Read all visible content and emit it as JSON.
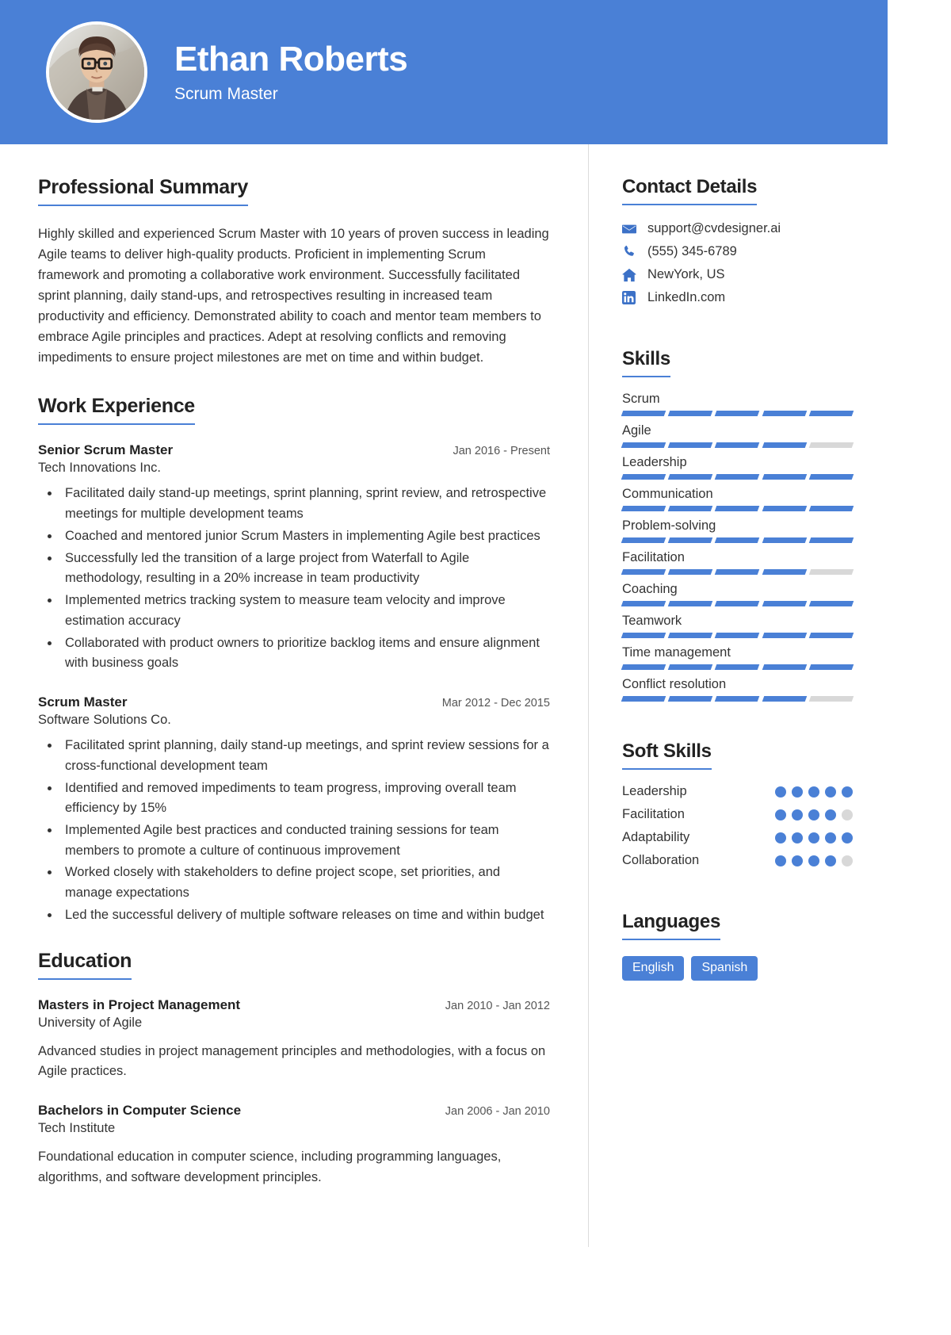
{
  "header": {
    "name": "Ethan Roberts",
    "title": "Scrum Master",
    "avatar_icon": "person-photo-avatar",
    "background_color": "#4a80d6"
  },
  "accent_color": "#4a80d6",
  "muted_color": "#d8d8d8",
  "summary": {
    "heading": "Professional Summary",
    "text": "Highly skilled and experienced Scrum Master with 10 years of proven success in leading Agile teams to deliver high-quality products. Proficient in implementing Scrum framework and promoting a collaborative work environment. Successfully facilitated sprint planning, daily stand-ups, and retrospectives resulting in increased team productivity and efficiency. Demonstrated ability to coach and mentor team members to embrace Agile principles and practices. Adept at resolving conflicts and removing impediments to ensure project milestones are met on time and within budget."
  },
  "work": {
    "heading": "Work Experience",
    "entries": [
      {
        "role": "Senior Scrum Master",
        "date": "Jan 2016 - Present",
        "org": "Tech Innovations Inc.",
        "bullets": [
          "Facilitated daily stand-up meetings, sprint planning, sprint review, and retrospective meetings for multiple development teams",
          "Coached and mentored junior Scrum Masters in implementing Agile best practices",
          "Successfully led the transition of a large project from Waterfall to Agile methodology, resulting in a 20% increase in team productivity",
          "Implemented metrics tracking system to measure team velocity and improve estimation accuracy",
          "Collaborated with product owners to prioritize backlog items and ensure alignment with business goals"
        ]
      },
      {
        "role": "Scrum Master",
        "date": "Mar 2012 - Dec 2015",
        "org": "Software Solutions Co.",
        "bullets": [
          "Facilitated sprint planning, daily stand-up meetings, and sprint review sessions for a cross-functional development team",
          "Identified and removed impediments to team progress, improving overall team efficiency by 15%",
          "Implemented Agile best practices and conducted training sessions for team members to promote a culture of continuous improvement",
          "Worked closely with stakeholders to define project scope, set priorities, and manage expectations",
          "Led the successful delivery of multiple software releases on time and within budget"
        ]
      }
    ]
  },
  "education": {
    "heading": "Education",
    "entries": [
      {
        "degree": "Masters in Project Management",
        "date": "Jan 2010 - Jan 2012",
        "school": "University of Agile",
        "description": "Advanced studies in project management principles and methodologies, with a focus on Agile practices."
      },
      {
        "degree": "Bachelors in Computer Science",
        "date": "Jan 2006 - Jan 2010",
        "school": "Tech Institute",
        "description": "Foundational education in computer science, including programming languages, algorithms, and software development principles."
      }
    ]
  },
  "contact": {
    "heading": "Contact Details",
    "items": [
      {
        "icon": "envelope-icon",
        "value": "support@cvdesigner.ai"
      },
      {
        "icon": "phone-icon",
        "value": "(555) 345-6789"
      },
      {
        "icon": "home-icon",
        "value": "NewYork, US"
      },
      {
        "icon": "linkedin-icon",
        "value": "LinkedIn.com"
      }
    ]
  },
  "skills": {
    "heading": "Skills",
    "max": 5,
    "items": [
      {
        "name": "Scrum",
        "level": 5
      },
      {
        "name": "Agile",
        "level": 4
      },
      {
        "name": "Leadership",
        "level": 5
      },
      {
        "name": "Communication",
        "level": 5
      },
      {
        "name": "Problem-solving",
        "level": 5
      },
      {
        "name": "Facilitation",
        "level": 4
      },
      {
        "name": "Coaching",
        "level": 5
      },
      {
        "name": "Teamwork",
        "level": 5
      },
      {
        "name": "Time management",
        "level": 5
      },
      {
        "name": "Conflict resolution",
        "level": 4
      }
    ]
  },
  "soft_skills": {
    "heading": "Soft Skills",
    "max": 5,
    "items": [
      {
        "name": "Leadership",
        "level": 5
      },
      {
        "name": "Facilitation",
        "level": 4
      },
      {
        "name": "Adaptability",
        "level": 5
      },
      {
        "name": "Collaboration",
        "level": 4
      }
    ]
  },
  "languages": {
    "heading": "Languages",
    "items": [
      "English",
      "Spanish"
    ]
  }
}
